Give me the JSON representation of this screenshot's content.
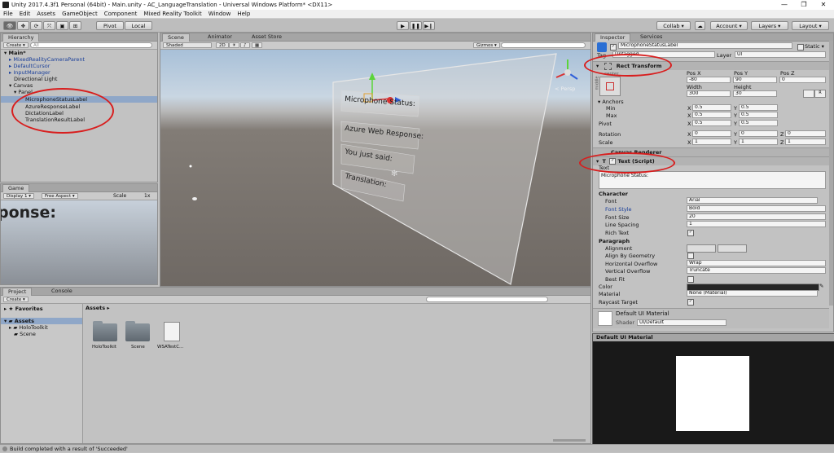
{
  "window": {
    "title": "Unity 2017.4.3f1 Personal (64bit) - Main.unity - AC_LanguageTranslation - Universal Windows Platform* <DX11>"
  },
  "menu": [
    "File",
    "Edit",
    "Assets",
    "GameObject",
    "Component",
    "Mixed Reality Toolkit",
    "Window",
    "Help"
  ],
  "toolbar": {
    "pivot": "Pivot",
    "local": "Local",
    "collab": "Collab ▾",
    "account": "Account ▾",
    "layers": "Layers ▾",
    "layout": "Layout ▾"
  },
  "hierarchy": {
    "tab": "Hierarchy",
    "create": "Create ▾",
    "search_placeholder": "All",
    "scene": "Main*",
    "items": [
      {
        "label": "MixedRealityCameraParent"
      },
      {
        "label": "DefaultCursor"
      },
      {
        "label": "InputManager"
      },
      {
        "label": "Directional Light"
      },
      {
        "label": "Canvas"
      },
      {
        "label": "Panel"
      },
      {
        "label": "MicrophoneStatusLabel"
      },
      {
        "label": "AzureResponseLabel"
      },
      {
        "label": "DictationLabel"
      },
      {
        "label": "TranslationResultLabel"
      }
    ]
  },
  "scene": {
    "tabs": [
      "Scene",
      "Animator",
      "Asset Store"
    ],
    "shading": "Shaded",
    "mode_2d": "2D",
    "gizmos": "Gizmos ▾",
    "canvas_labels": [
      "Microphone Status:",
      "Azure Web Response:",
      "You just said:",
      "Translation:"
    ],
    "persp": "< Persp"
  },
  "game": {
    "tab": "Game",
    "display": "Display 1",
    "aspect": "Free Aspect",
    "scale_label": "Scale",
    "scale_value": "1x",
    "preview_text": "ponse:"
  },
  "project": {
    "tabs": [
      "Project",
      "Console"
    ],
    "create": "Create ▾",
    "favorites": "Favorites",
    "assets_root": "Assets",
    "tree": [
      "HoloToolkit",
      "Scene"
    ],
    "breadcrumb": "Assets ▸",
    "items": [
      {
        "label": "HoloToolkit"
      },
      {
        "label": "Scene"
      },
      {
        "label": "WSATestC..."
      }
    ]
  },
  "inspector": {
    "tabs": [
      "Inspector",
      "Services"
    ],
    "object_name": "MicrophoneStatusLabel",
    "static_label": "Static ▾",
    "tag_label": "Tag",
    "tag_value": "Untagged",
    "layer_label": "Layer",
    "layer_value": "UI",
    "rect_transform": {
      "title": "Rect Transform",
      "center": "center",
      "middle": "middle",
      "pos_x_label": "Pos X",
      "pos_y_label": "Pos Y",
      "pos_z_label": "Pos Z",
      "pos_x": "-80",
      "pos_y": "90",
      "pos_z": "0",
      "width_label": "Width",
      "height_label": "Height",
      "width": "300",
      "height": "30",
      "anchors": "Anchors",
      "min": "Min",
      "min_x": "0.5",
      "min_y": "0.5",
      "max": "Max",
      "max_x": "0.5",
      "max_y": "0.5",
      "pivot": "Pivot",
      "pivot_x": "0.5",
      "pivot_y": "0.5",
      "rotation": "Rotation",
      "rot_x": "0",
      "rot_y": "0",
      "rot_z": "0",
      "scale": "Scale",
      "scale_x": "1",
      "scale_y": "1",
      "scale_z": "1"
    },
    "canvas_renderer": "Canvas Renderer",
    "text_script": {
      "title": "Text (Script)",
      "text_label": "Text",
      "text_value": "Microphone Status:",
      "character": "Character",
      "font_label": "Font",
      "font_value": "Arial",
      "font_style_label": "Font Style",
      "font_style_value": "Bold",
      "font_size_label": "Font Size",
      "font_size_value": "20",
      "line_spacing_label": "Line Spacing",
      "line_spacing_value": "1",
      "rich_text_label": "Rich Text",
      "paragraph": "Paragraph",
      "alignment_label": "Alignment",
      "align_geom_label": "Align By Geometry",
      "h_overflow_label": "Horizontal Overflow",
      "h_overflow_value": "Wrap",
      "v_overflow_label": "Vertical Overflow",
      "v_overflow_value": "Truncate",
      "best_fit_label": "Best Fit",
      "color_label": "Color",
      "material_label": "Material",
      "material_value": "None (Material)",
      "raycast_label": "Raycast Target"
    },
    "material": {
      "name": "Default UI Material",
      "shader_label": "Shader",
      "shader_value": "UI/Default"
    },
    "preview_title": "Default UI Material"
  },
  "status": {
    "message": "Build completed with a result of 'Succeeded'"
  },
  "colors": {
    "annotation": "#d81e1e",
    "selection": "#8fa7c8",
    "link": "#1a3f9a"
  }
}
